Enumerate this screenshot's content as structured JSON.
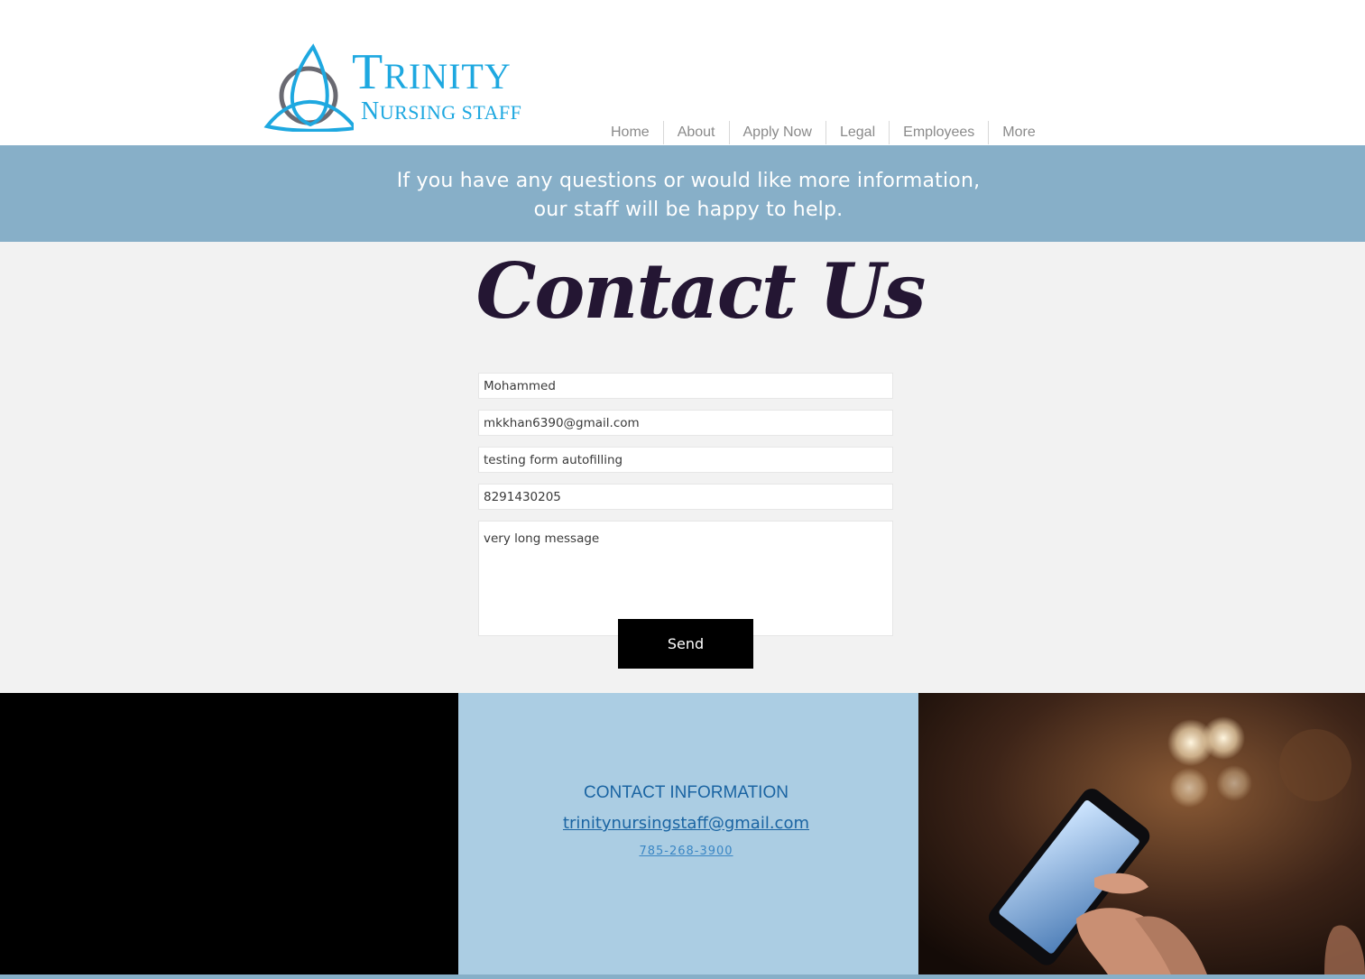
{
  "logo": {
    "word1_initial": "T",
    "word1_rest": "RINITY",
    "word2_initial": "N",
    "word2_rest": "URSING STAFF"
  },
  "nav": {
    "items": [
      "Home",
      "About",
      "Apply Now",
      "Legal",
      "Employees",
      "More"
    ]
  },
  "banner": {
    "line1": "If you have any questions or would like more information,",
    "line2": "our staff will be happy to help."
  },
  "contact": {
    "title": "Contact Us",
    "name_value": "Mohammed",
    "email_value": "mkkhan6390@gmail.com",
    "subject_value": "testing form autofilling",
    "phone_value": "8291430205",
    "message_value": "very long message",
    "send_label": "Send"
  },
  "footer": {
    "title": "CONTACT INFORMATION",
    "email": "trinitynursingstaff@gmail.com",
    "phone": "785-268-3900"
  },
  "colors": {
    "brand_blue": "#1ea8e0",
    "banner": "#87afc8",
    "info_panel": "#abcde3",
    "title_dark": "#241633"
  }
}
